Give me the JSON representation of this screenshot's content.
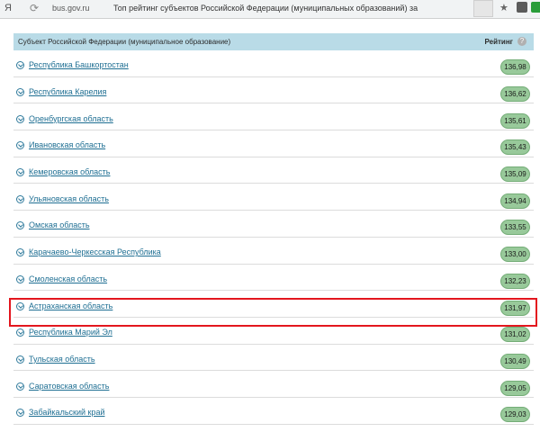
{
  "browser": {
    "logo": "Я",
    "url_host": "bus.gov.ru",
    "tab_title": "Топ рейтинг субъектов Российской Федерации (муниципальных образований) за"
  },
  "table": {
    "header": {
      "subject": "Субъект Российской Федерации (муниципальное образование)",
      "rating": "Рейтинг",
      "help": "?"
    },
    "rows": [
      {
        "name": "Республика Башкортостан",
        "rating": "136,98"
      },
      {
        "name": "Республика Карелия",
        "rating": "136,62"
      },
      {
        "name": "Оренбургская область",
        "rating": "135,61"
      },
      {
        "name": "Ивановская область",
        "rating": "135,43"
      },
      {
        "name": "Кемеровская область",
        "rating": "135,09"
      },
      {
        "name": "Ульяновская область",
        "rating": "134,94"
      },
      {
        "name": "Омская область",
        "rating": "133,55"
      },
      {
        "name": "Карачаево-Черкесская Республика",
        "rating": "133,00"
      },
      {
        "name": "Смоленская область",
        "rating": "132,23"
      },
      {
        "name": "Астраханская область",
        "rating": "131,97"
      },
      {
        "name": "Республика Марий Эл",
        "rating": "131,02"
      },
      {
        "name": "Тульская область",
        "rating": "130,49"
      },
      {
        "name": "Саратовская область",
        "rating": "129,05"
      },
      {
        "name": "Забайкальский край",
        "rating": "129,03"
      }
    ]
  },
  "highlight_color": "#e3161e"
}
